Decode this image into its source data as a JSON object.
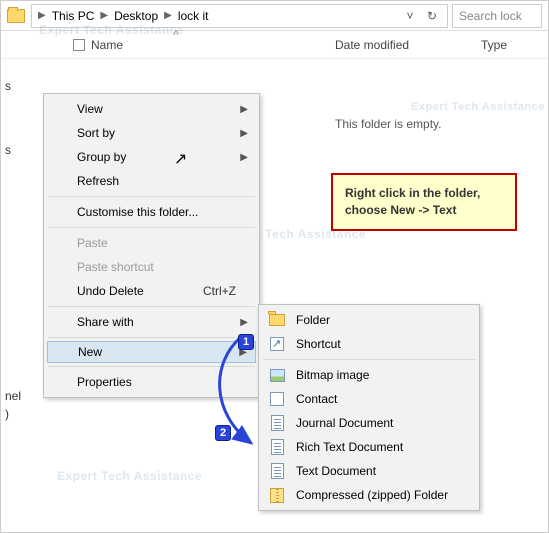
{
  "breadcrumb": {
    "root": "This PC",
    "mid": "Desktop",
    "leaf": "lock it"
  },
  "search_placeholder": "Search lock",
  "columns": {
    "name": "Name",
    "date": "Date modified",
    "type": "Type"
  },
  "empty_text": "This folder is empty.",
  "menu1": {
    "view": "View",
    "sortby": "Sort by",
    "groupby": "Group by",
    "refresh": "Refresh",
    "customise": "Customise this folder...",
    "paste": "Paste",
    "paste_shortcut": "Paste shortcut",
    "undo_delete": "Undo Delete",
    "undo_shortcut": "Ctrl+Z",
    "share": "Share with",
    "new": "New",
    "properties": "Properties"
  },
  "menu2": {
    "folder": "Folder",
    "shortcut": "Shortcut",
    "bitmap": "Bitmap image",
    "contact": "Contact",
    "journal": "Journal Document",
    "rtf": "Rich Text Document",
    "txt": "Text Document",
    "zip": "Compressed (zipped) Folder"
  },
  "badges": {
    "one": "1",
    "two": "2"
  },
  "tip_line1": "Right click in the folder,",
  "tip_line2": "choose New -> Text",
  "watermark": "Expert Tech Assistance",
  "leftedge": {
    "a": "s",
    "b": "s",
    "c": "nel",
    "d": ")"
  }
}
